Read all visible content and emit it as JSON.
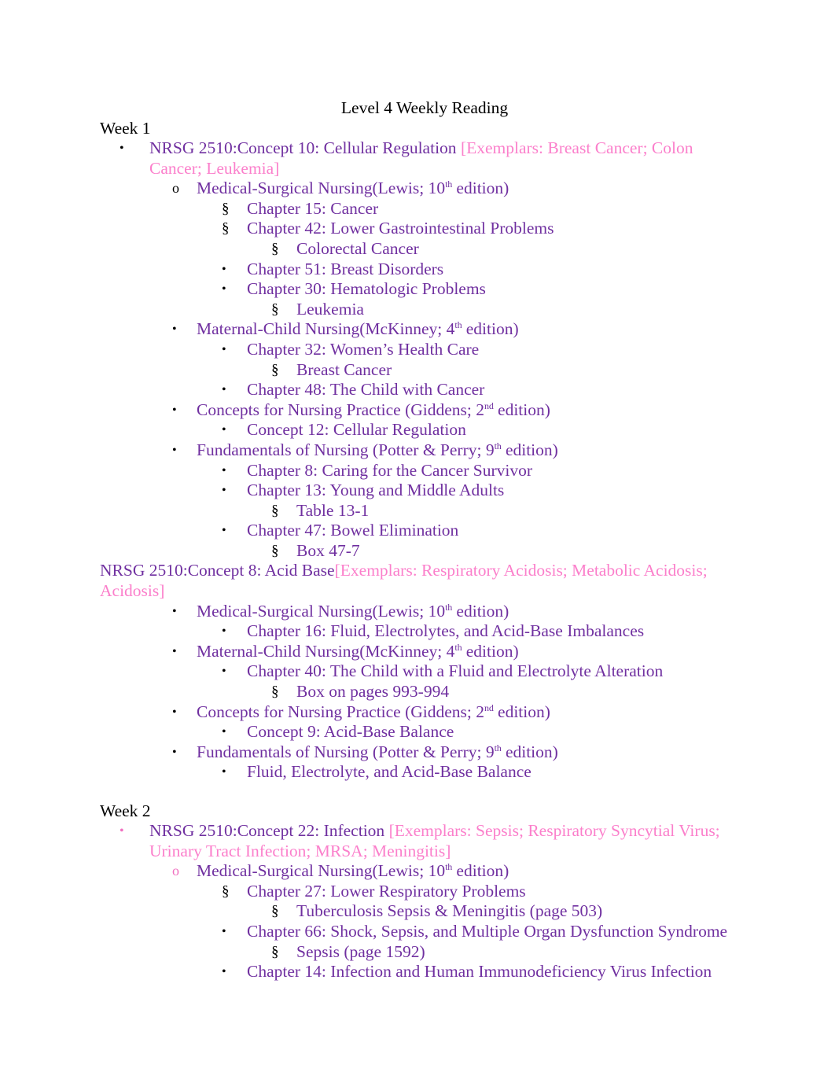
{
  "document": {
    "title": "Level 4 Weekly Reading",
    "colors": {
      "body_purple": "#7030A0",
      "exemplar_pink": "#FB7FCB",
      "marker_black": "#000000",
      "marker_pink": "#F06FC0",
      "title_black": "#000000",
      "page_background": "#FFFFFF"
    }
  },
  "weeks": [
    {
      "heading": "Week 1",
      "lines": [
        {
          "marker": "•",
          "text": "NRSG 2510:Concept 10: Cellular Regulation ",
          "exemplar": "[Exemplars: Breast Cancer; Colon Cancer; Leukemia]"
        },
        {
          "marker": "o",
          "text": "Medical-Surgical Nursing(Lewis; 10",
          "sup": "th",
          "text2": " edition)"
        },
        {
          "marker": "§",
          "text": "Chapter 15: Cancer"
        },
        {
          "marker": "§",
          "text": "Chapter 42: Lower Gastrointestinal Problems"
        },
        {
          "marker": "§",
          "text": "Colorectal Cancer"
        },
        {
          "marker": "•",
          "text": "Chapter 51: Breast Disorders"
        },
        {
          "marker": "•",
          "text": "Chapter 30: Hematologic Problems"
        },
        {
          "marker": "§",
          "text": "Leukemia"
        },
        {
          "marker": "•",
          "text": "Maternal-Child Nursing(McKinney; 4",
          "sup": "th",
          "text2": " edition)"
        },
        {
          "marker": "•",
          "text": "Chapter 32: Women’s Health Care"
        },
        {
          "marker": "§",
          "text": "Breast Cancer"
        },
        {
          "marker": "•",
          "text": "Chapter 48: The Child with Cancer"
        },
        {
          "marker": "•",
          "text": "Concepts for Nursing Practice (Giddens; 2",
          "sup": "nd",
          "text2": " edition)"
        },
        {
          "marker": "•",
          "text": "Concept 12: Cellular Regulation"
        },
        {
          "marker": "•",
          "text": "Fundamentals of Nursing (Potter & Perry; 9",
          "sup": "th",
          "text2": " edition)"
        },
        {
          "marker": "•",
          "text": "Chapter 8: Caring for the Cancer Survivor"
        },
        {
          "marker": "•",
          "text": "Chapter 13: Young and Middle Adults"
        },
        {
          "marker": "§",
          "text": "Table 13-1"
        },
        {
          "marker": "•",
          "text": "Chapter 47: Bowel Elimination"
        },
        {
          "marker": "§",
          "text": "Box 47-7"
        },
        {
          "marker": "",
          "text": "NRSG 2510:Concept 8: Acid Base",
          "exemplar": "[Exemplars: Respiratory Acidosis; Metabolic Acidosis; Acidosis]"
        },
        {
          "marker": "•",
          "text": "Medical-Surgical Nursing(Lewis; 10",
          "sup": "th",
          "text2": " edition)"
        },
        {
          "marker": "•",
          "text": "Chapter 16: Fluid, Electrolytes, and Acid-Base Imbalances"
        },
        {
          "marker": "•",
          "text": "Maternal-Child Nursing(McKinney; 4",
          "sup": "th",
          "text2": " edition)"
        },
        {
          "marker": "•",
          "text": "Chapter 40: The Child with a Fluid and Electrolyte Alteration"
        },
        {
          "marker": "§",
          "text": "Box on pages 993-994"
        },
        {
          "marker": "•",
          "text": "Concepts for Nursing Practice (Giddens; 2",
          "sup": "nd",
          "text2": " edition)"
        },
        {
          "marker": "•",
          "text": "Concept 9: Acid-Base Balance"
        },
        {
          "marker": "•",
          "text": "Fundamentals of Nursing (Potter & Perry; 9",
          "sup": "th",
          "text2": " edition)"
        },
        {
          "marker": "•",
          "text": "Fluid, Electrolyte, and Acid-Base Balance"
        }
      ]
    },
    {
      "heading": "Week 2",
      "lines": [
        {
          "marker": "•",
          "text": "NRSG 2510:Concept 22: Infection ",
          "exemplar": "[Exemplars: Sepsis; Respiratory Syncytial Virus; Urinary Tract Infection; MRSA; Meningitis]"
        },
        {
          "marker": "o",
          "text": "Medical-Surgical Nursing(Lewis; 10",
          "sup": "th",
          "text2": " edition)"
        },
        {
          "marker": "§",
          "text": "Chapter 27: Lower Respiratory Problems"
        },
        {
          "marker": "§",
          "text": "Tuberculosis Sepsis & Meningitis (page 503)"
        },
        {
          "marker": "•",
          "text": "Chapter 66: Shock, Sepsis, and Multiple Organ Dysfunction Syndrome"
        },
        {
          "marker": "§",
          "text": "Sepsis (page 1592)"
        },
        {
          "marker": "•",
          "text": "Chapter 14: Infection and Human Immunodeficiency Virus Infection"
        }
      ]
    }
  ],
  "w1": {
    "l0_txt": "NRSG 2510:Concept 10: Cellular Regulation ",
    "l0_ex": "[Exemplars: Breast Cancer; Colon Cancer; Leukemia]",
    "l1_a": "Medical-Surgical Nursing(Lewis; 10",
    "l1_s": "th",
    "l1_b": " edition)",
    "l2": "Chapter 15: Cancer",
    "l3": "Chapter 42: Lower Gastrointestinal Problems",
    "l4": "Colorectal Cancer",
    "l5": "Chapter 51: Breast Disorders",
    "l6": "Chapter 30: Hematologic Problems",
    "l7": "Leukemia",
    "l8_a": "Maternal-Child Nursing(McKinney; 4",
    "l8_s": "th",
    "l8_b": " edition)",
    "l9": "Chapter 32: Women’s Health Care",
    "l10": "Breast Cancer",
    "l11": "Chapter 48: The Child with Cancer",
    "l12_a": "Concepts for Nursing Practice (Giddens; 2",
    "l12_s": "nd",
    "l12_b": " edition)",
    "l13": "Concept 12: Cellular Regulation",
    "l14_a": "Fundamentals of Nursing (Potter & Perry; 9",
    "l14_s": "th",
    "l14_b": " edition)",
    "l15": "Chapter 8: Caring for the Cancer Survivor",
    "l16": "Chapter 13: Young and Middle Adults",
    "l17": "Table 13-1",
    "l18": "Chapter 47: Bowel Elimination",
    "l19": "Box 47-7",
    "l20_txt": "NRSG 2510:Concept 8: Acid Base",
    "l20_ex": "[Exemplars: Respiratory Acidosis; Metabolic Acidosis; Acidosis]",
    "l21_a": "Medical-Surgical Nursing(Lewis; 10",
    "l21_s": "th",
    "l21_b": " edition)",
    "l22": "Chapter 16: Fluid, Electrolytes, and Acid-Base Imbalances",
    "l23_a": "Maternal-Child Nursing(McKinney; 4",
    "l23_s": "th",
    "l23_b": " edition)",
    "l24": "Chapter 40: The Child with a Fluid and Electrolyte Alteration",
    "l25": "Box on pages 993-994",
    "l26_a": "Concepts for Nursing Practice (Giddens; 2",
    "l26_s": "nd",
    "l26_b": " edition)",
    "l27": "Concept 9: Acid-Base Balance",
    "l28_a": "Fundamentals of Nursing (Potter & Perry; 9",
    "l28_s": "th",
    "l28_b": " edition)",
    "l29": "Fluid, Electrolyte, and Acid-Base Balance"
  },
  "w2": {
    "l0_txt": "NRSG 2510:Concept 22: Infection ",
    "l0_ex": "[Exemplars: Sepsis; Respiratory Syncytial Virus; Urinary Tract Infection; MRSA; Meningitis]",
    "l1_a": "Medical-Surgical Nursing(Lewis; 10",
    "l1_s": "th",
    "l1_b": " edition)",
    "l2": "Chapter 27: Lower Respiratory Problems",
    "l3": "Tuberculosis Sepsis & Meningitis (page 503)",
    "l4": "Chapter 66: Shock, Sepsis, and Multiple Organ Dysfunction Syndrome",
    "l5": "Sepsis (page 1592)",
    "l6": "Chapter 14: Infection and Human Immunodeficiency Virus Infection"
  },
  "markers": {
    "bullet": "•",
    "circle": "o",
    "section": "§"
  }
}
